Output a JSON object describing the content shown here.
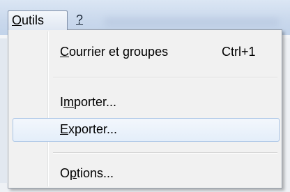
{
  "menubar": {
    "outils": {
      "prefix": "",
      "accel": "O",
      "rest": "utils"
    },
    "help": {
      "label": "?"
    }
  },
  "menu": {
    "items": [
      {
        "prefix": "",
        "accel": "C",
        "rest": "ourrier et groupes",
        "shortcut": "Ctrl+1"
      },
      {
        "prefix": "I",
        "accel": "m",
        "rest": "porter...",
        "shortcut": ""
      },
      {
        "prefix": "",
        "accel": "E",
        "rest": "xporter...",
        "shortcut": "",
        "highlighted": true
      },
      {
        "prefix": "O",
        "accel": "p",
        "rest": "tions...",
        "shortcut": ""
      }
    ]
  },
  "colors": {
    "highlight_border": "#a9c4e6",
    "menu_bg": "#f1f1f1"
  }
}
